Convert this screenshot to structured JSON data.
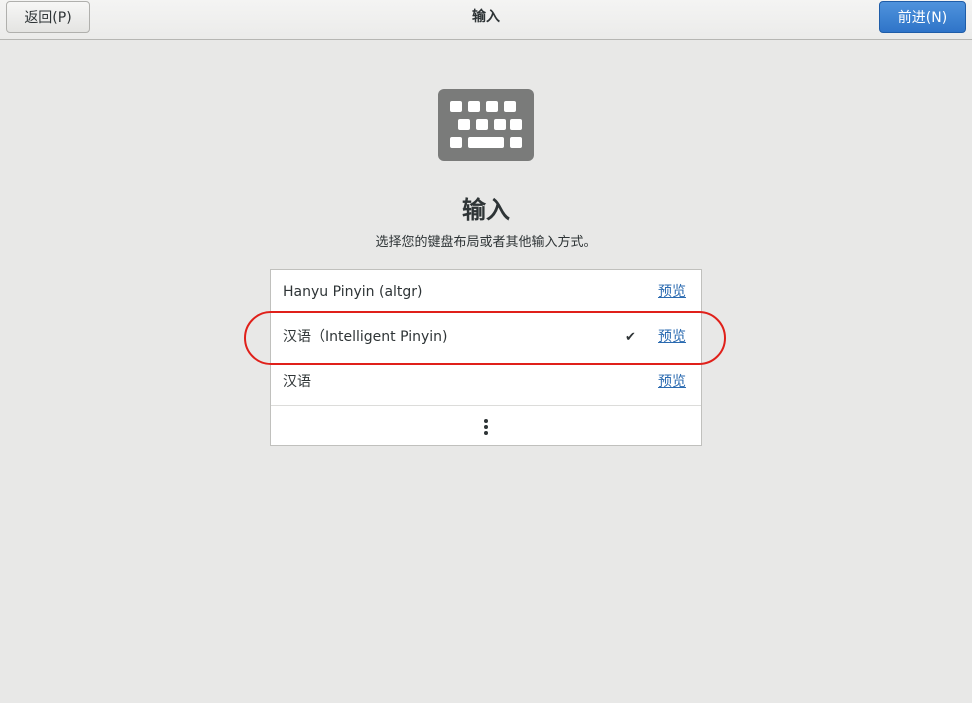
{
  "header": {
    "back_label": "返回(P)",
    "title": "输入",
    "next_label": "前进(N)"
  },
  "main": {
    "title": "输入",
    "subtitle": "选择您的键盘布局或者其他输入方式。"
  },
  "input_sources": [
    {
      "label": "Hanyu Pinyin (altgr)",
      "selected": false,
      "preview_label": "预览"
    },
    {
      "label": "汉语（Intelligent Pinyin)",
      "selected": true,
      "check": "✔",
      "preview_label": "预览"
    },
    {
      "label": "汉语",
      "selected": false,
      "preview_label": "预览"
    }
  ],
  "colors": {
    "accent": "#2f74c8",
    "link": "#2a6ab0",
    "highlight": "#e0201a"
  },
  "icons": {
    "hero": "keyboard-icon",
    "more": "more-vertical-icon",
    "check": "checkmark-icon"
  }
}
